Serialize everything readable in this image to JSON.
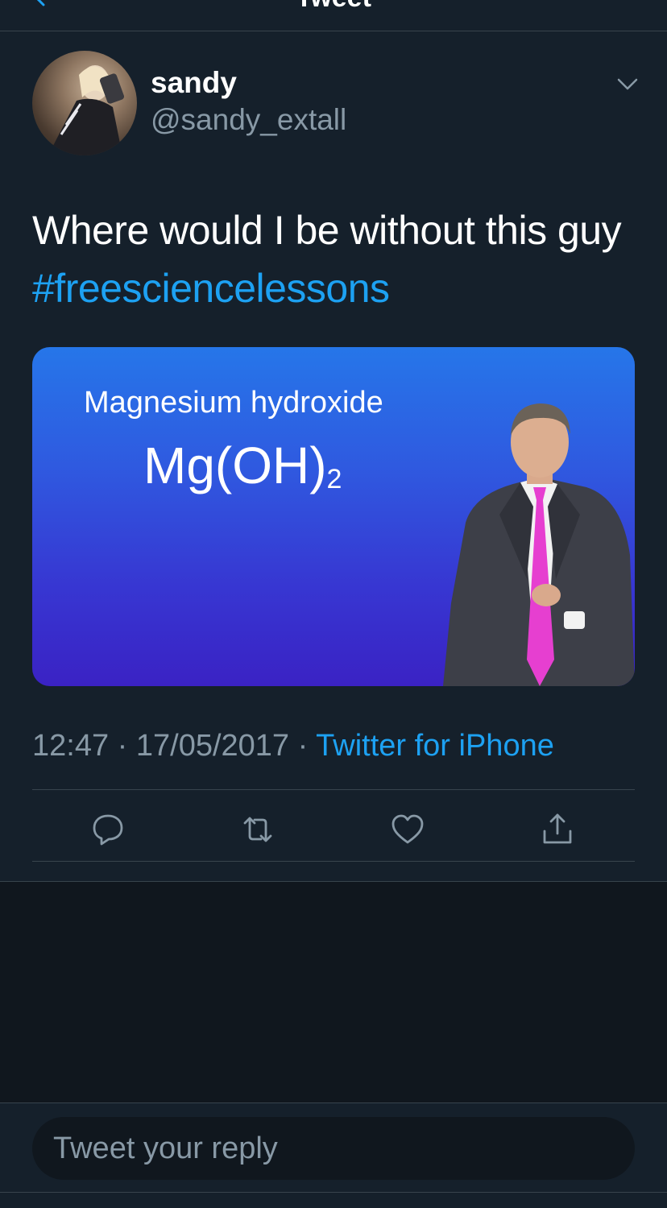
{
  "header": {
    "title": "Tweet"
  },
  "tweet": {
    "author_name": "sandy",
    "author_handle": "@sandy_extall",
    "text": "Where would I be without this guy ",
    "hashtag": "#freesciencelessons",
    "media": {
      "title": "Magnesium hydroxide",
      "formula_main": "Mg(OH)",
      "formula_sub": "2"
    },
    "time": "12:47",
    "date": "17/05/2017",
    "separator": " · ",
    "source": "Twitter for iPhone"
  },
  "actions": {
    "reply_icon": "reply-icon",
    "retweet_icon": "retweet-icon",
    "like_icon": "heart-icon",
    "share_icon": "share-icon"
  },
  "reply": {
    "placeholder": "Tweet your reply"
  },
  "colors": {
    "background": "#15202b",
    "accent": "#1da1f2",
    "muted": "#8899a6",
    "divider": "#38444d"
  }
}
